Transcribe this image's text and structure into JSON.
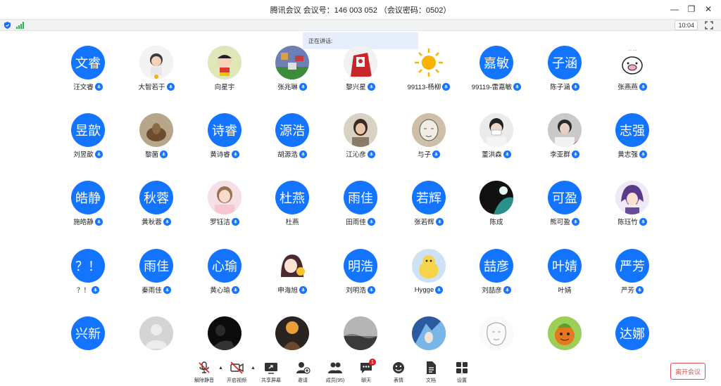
{
  "window": {
    "title": "腾讯会议 会议号：146 003 052 （会议密码：0502）",
    "minimize_glyph": "—",
    "restore_glyph": "❐",
    "close_glyph": "✕"
  },
  "status": {
    "time": "10:04",
    "shield_color": "#1a6ef5",
    "signal_color": "#2bb24c"
  },
  "speaking": {
    "label": "正在讲话:"
  },
  "accent": "#1274ff",
  "participants": [
    {
      "name": "汪文睿",
      "avatar_text": "文睿",
      "mic": true
    },
    {
      "name": "大智若于",
      "avatar_text": "",
      "mic": true,
      "image": "cartoon-boy"
    },
    {
      "name": "向星宇",
      "avatar_text": "",
      "mic": false,
      "image": "crayon-shin"
    },
    {
      "name": "张兆琳",
      "avatar_text": "",
      "mic": true,
      "image": "pixel-game"
    },
    {
      "name": "黎兴星",
      "avatar_text": "",
      "mic": true,
      "image": "red-figure"
    },
    {
      "name": "99113-杨柳",
      "avatar_text": "",
      "mic": true,
      "image": "sun"
    },
    {
      "name": "99119-雷嘉敏",
      "avatar_text": "嘉敏",
      "mic": true
    },
    {
      "name": "陈子涵",
      "avatar_text": "子涵",
      "mic": true
    },
    {
      "name": "张燕燕",
      "avatar_text": "",
      "mic": true,
      "image": "pig"
    },
    {
      "name": "刘昱歆",
      "avatar_text": "昱歆",
      "mic": true
    },
    {
      "name": "黎菌",
      "avatar_text": "",
      "mic": true,
      "image": "brown-photo"
    },
    {
      "name": "黄诗睿",
      "avatar_text": "诗睿",
      "mic": true
    },
    {
      "name": "胡源浩",
      "avatar_text": "源浩",
      "mic": true
    },
    {
      "name": "江沁彦",
      "avatar_text": "",
      "mic": true,
      "image": "girl-photo"
    },
    {
      "name": "与子",
      "avatar_text": "",
      "mic": true,
      "image": "sketch-face"
    },
    {
      "name": "董洪森",
      "avatar_text": "",
      "mic": true,
      "image": "masked-person"
    },
    {
      "name": "李亚群",
      "avatar_text": "",
      "mic": true,
      "image": "boy-photo"
    },
    {
      "name": "黄志强",
      "avatar_text": "志强",
      "mic": true
    },
    {
      "name": "施皓静",
      "avatar_text": "皓静",
      "mic": true
    },
    {
      "name": "黄秋蓉",
      "avatar_text": "秋蓉",
      "mic": true
    },
    {
      "name": "罗钰洁",
      "avatar_text": "",
      "mic": true,
      "image": "pink-girl"
    },
    {
      "name": "杜燕",
      "avatar_text": "杜燕",
      "mic": false
    },
    {
      "name": "田雨佳",
      "avatar_text": "雨佳",
      "mic": true
    },
    {
      "name": "张若辉",
      "avatar_text": "若辉",
      "mic": true
    },
    {
      "name": "陈成",
      "avatar_text": "",
      "mic": false,
      "image": "dark-teal"
    },
    {
      "name": "熊可盈",
      "avatar_text": "可盈",
      "mic": true
    },
    {
      "name": "陈珏竹",
      "avatar_text": "",
      "mic": true,
      "image": "anime-purple"
    },
    {
      "name": "？！",
      "avatar_text": "？！",
      "mic": true
    },
    {
      "name": "秦雨佳",
      "avatar_text": "雨佳",
      "mic": true
    },
    {
      "name": "黄心瑜",
      "avatar_text": "心瑜",
      "mic": true
    },
    {
      "name": "申海旭",
      "avatar_text": "",
      "mic": true,
      "image": "anime-girl"
    },
    {
      "name": "刘明浩",
      "avatar_text": "明浩",
      "mic": true
    },
    {
      "name": "Hygge",
      "avatar_text": "",
      "mic": true,
      "image": "yellow-duck"
    },
    {
      "name": "刘喆彦",
      "avatar_text": "喆彦",
      "mic": true
    },
    {
      "name": "叶婧",
      "avatar_text": "叶婧",
      "mic": false
    },
    {
      "name": "严芳",
      "avatar_text": "严芳",
      "mic": true
    },
    {
      "name": "",
      "avatar_text": "兴新",
      "mic": false
    },
    {
      "name": "",
      "avatar_text": "",
      "mic": false,
      "image": "default-person"
    },
    {
      "name": "",
      "avatar_text": "",
      "mic": false,
      "image": "silhouette"
    },
    {
      "name": "",
      "avatar_text": "",
      "mic": false,
      "image": "orange-night"
    },
    {
      "name": "",
      "avatar_text": "",
      "mic": false,
      "image": "gray-sea"
    },
    {
      "name": "",
      "avatar_text": "",
      "mic": false,
      "image": "blue-anime"
    },
    {
      "name": "",
      "avatar_text": "",
      "mic": false,
      "image": "sketch-lines"
    },
    {
      "name": "",
      "avatar_text": "",
      "mic": false,
      "image": "orange-character"
    },
    {
      "name": "",
      "avatar_text": "达娜",
      "mic": false
    }
  ],
  "toolbar": {
    "unmute": "解除静音",
    "start_video": "开启视频",
    "share_screen": "共享屏幕",
    "invite": "邀请",
    "members": "成员(95)",
    "chat": "聊天",
    "chat_badge": "1",
    "reactions": "表情",
    "docs": "文档",
    "settings": "设置",
    "leave": "离开会议",
    "caret_glyph": "▲"
  }
}
